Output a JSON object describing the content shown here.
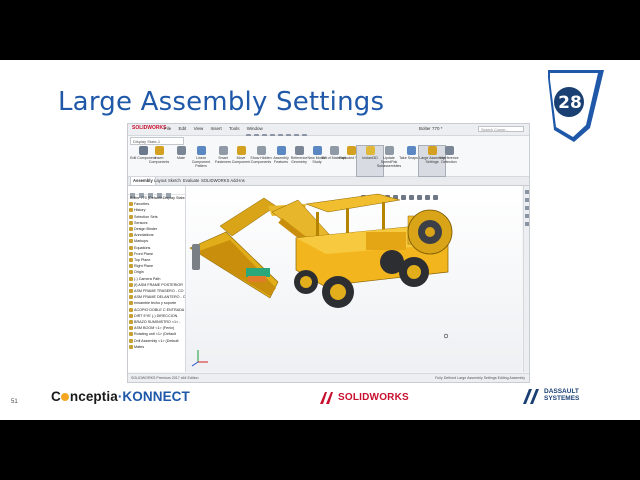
{
  "slide": {
    "title": "Large Assembly Settings",
    "badge_number": "28",
    "page_number": "51",
    "accent_color": "#1f58a8"
  },
  "app": {
    "brand": "SOLIDWORKS",
    "menus": [
      "File",
      "Edit",
      "View",
      "Insert",
      "Tools",
      "Window"
    ],
    "document_title": "Bolter 770 *",
    "search_placeholder": "Search Comm...",
    "display_style": "Display State-1",
    "ribbon": [
      {
        "label": "Edit Component",
        "color": "#6a7a8c"
      },
      {
        "label": "Insert Components",
        "color": "#d4a020"
      },
      {
        "label": "Mate",
        "color": "#7a8696"
      },
      {
        "label": "Linear Component Pattern",
        "color": "#5b87c2"
      },
      {
        "label": "Smart Fasteners",
        "color": "#8f9aa6"
      },
      {
        "label": "Move Component",
        "color": "#d4a020"
      },
      {
        "label": "Show Hidden Components",
        "color": "#8f9aa6"
      },
      {
        "label": "Assembly Features",
        "color": "#5b87c2"
      },
      {
        "label": "Reference Geometry",
        "color": "#7a8696"
      },
      {
        "label": "New Motion Study",
        "color": "#5b87c2"
      },
      {
        "label": "Bill of Materials",
        "color": "#8f9aa6"
      },
      {
        "label": "Exploded View",
        "color": "#d4a020"
      },
      {
        "label": "Instant3D",
        "color": "#e0b838",
        "active": true
      },
      {
        "label": "Update SpeedPak Subassemblies",
        "color": "#8f9aa6"
      },
      {
        "label": "Take Snapshot",
        "color": "#5b87c2"
      },
      {
        "label": "Large Assembly Settings",
        "color": "#d4a020",
        "active": true
      },
      {
        "label": "Interference Detection",
        "color": "#7a8696"
      }
    ],
    "tabs": [
      "Assembly",
      "Layout",
      "Sketch",
      "Evaluate",
      "SOLIDWORKS Add-Ins"
    ],
    "active_tab": "Assembly",
    "tree": [
      "Bolter 770 (Default<Display State-1>)",
      "Favorites",
      "History",
      "Selection Sets",
      "Sensors",
      "Design Binder",
      "Annotations",
      "Markups",
      "Equations",
      "Front Plane",
      "Top Plane",
      "Right Plane",
      "Origin",
      "(-) Camera Path",
      "(f) ASM FRAME POSTERIOR",
      "ASM FRAME TRASERO - CO",
      "ASM FRAME DELANTERO - C",
      "ensamble techo y soporte",
      "ACOPIO DOBLE C ENTRADA",
      "DIRT EYE (-) DIRECCION",
      "BRAZO SUMINISTRO <1> -",
      "ASM BOOM <1> (Fenix)",
      "Rotating unit <1> (Default",
      "Drill Assembly <1> (Default",
      "Mates"
    ],
    "status_left": "SOLIDWORKS Premium 2017 x64 Edition",
    "status_right": "Fully Defined   Large Assembly Settings   Editing Assembly"
  }
}
